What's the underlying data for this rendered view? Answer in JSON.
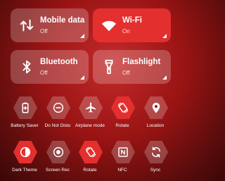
{
  "tiles": [
    {
      "name": "Mobile data",
      "status": "Off",
      "icon": "mobile-data-icon",
      "state": "off"
    },
    {
      "name": "Wi-Fi",
      "status": "On",
      "icon": "wifi-icon",
      "state": "on"
    },
    {
      "name": "Bluetooth",
      "status": "Off",
      "icon": "bluetooth-icon",
      "state": "off"
    },
    {
      "name": "Flashlight",
      "status": "Off",
      "icon": "flashlight-icon",
      "state": "off"
    }
  ],
  "quick_settings": [
    {
      "label": "Battery Saver",
      "icon": "battery-saver-icon",
      "state": "off"
    },
    {
      "label": "Do Not Distu",
      "icon": "do-not-disturb-icon",
      "state": "off"
    },
    {
      "label": "Airplane mode",
      "icon": "airplane-icon",
      "state": "off"
    },
    {
      "label": "Rotate",
      "icon": "rotate-icon",
      "state": "on"
    },
    {
      "label": "Location",
      "icon": "location-icon",
      "state": "off"
    },
    {
      "label": "Dark Theme",
      "icon": "dark-theme-icon",
      "state": "on"
    },
    {
      "label": "Screen Rec",
      "icon": "screen-record-icon",
      "state": "off"
    },
    {
      "label": "Rotate",
      "icon": "rotate-icon",
      "state": "on"
    },
    {
      "label": "NFC",
      "icon": "nfc-icon",
      "state": "off"
    },
    {
      "label": "Sync",
      "icon": "sync-icon",
      "state": "off"
    }
  ],
  "colors": {
    "accent": "#e3302f",
    "tile_off": "rgba(255,255,255,0.22)",
    "background": "#9a1414"
  }
}
